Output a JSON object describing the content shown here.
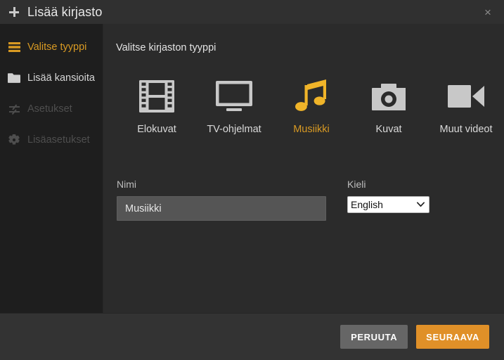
{
  "window": {
    "title": "Lisää kirjasto",
    "add_icon": "plus-icon",
    "close_label": "×"
  },
  "sidebar": {
    "items": [
      {
        "label": "Valitse tyyppi",
        "icon": "list-icon",
        "state": "active"
      },
      {
        "label": "Lisää kansioita",
        "icon": "folder-icon",
        "state": "enabled"
      },
      {
        "label": "Asetukset",
        "icon": "sliders-icon",
        "state": "disabled"
      },
      {
        "label": "Lisäasetukset",
        "icon": "gear-icon",
        "state": "disabled"
      }
    ]
  },
  "main": {
    "heading": "Valitse kirjaston tyyppi",
    "types": [
      {
        "label": "Elokuvat",
        "icon": "film-strip-icon",
        "selected": false
      },
      {
        "label": "TV-ohjelmat",
        "icon": "television-icon",
        "selected": false
      },
      {
        "label": "Musiikki",
        "icon": "music-note-icon",
        "selected": true
      },
      {
        "label": "Kuvat",
        "icon": "camera-icon",
        "selected": false
      },
      {
        "label": "Muut videot",
        "icon": "video-camera-icon",
        "selected": false
      }
    ],
    "name_field": {
      "label": "Nimi",
      "value": "Musiikki",
      "placeholder": ""
    },
    "language_field": {
      "label": "Kieli",
      "value": "English",
      "options": [
        "English"
      ],
      "chevron": "chevron-down-icon"
    }
  },
  "footer": {
    "cancel_label": "PERUUTA",
    "next_label": "SEURAAVA"
  },
  "colors": {
    "accent": "#d99a23",
    "accent_button": "#e09028",
    "icon_accent": "#f0b429",
    "cancel_button": "#666666",
    "window_bg": "#2b2b2b",
    "sidebar_bg": "#1e1e1e",
    "titlebar_bg": "#303030",
    "footer_bg": "#333333"
  }
}
